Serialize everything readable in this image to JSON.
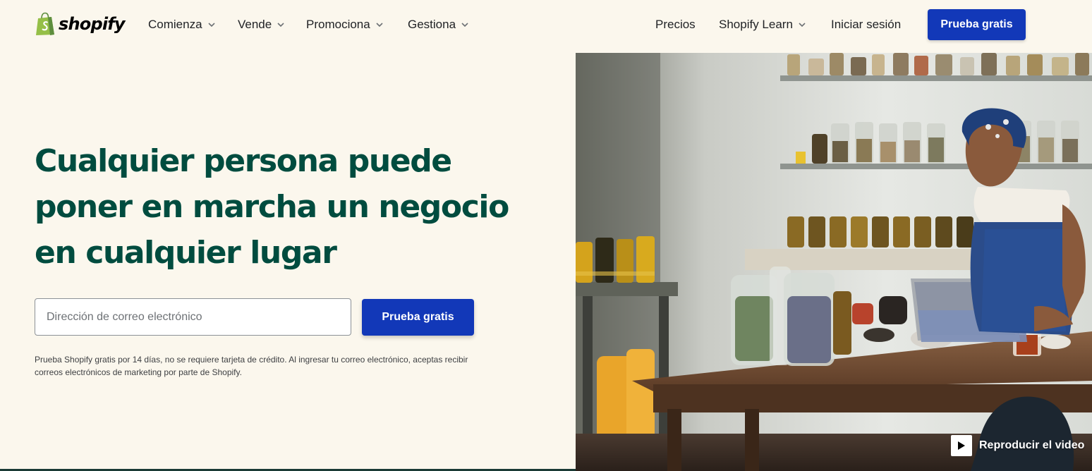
{
  "brand": {
    "name": "shopify",
    "color": "#95bf47"
  },
  "nav": {
    "left": [
      {
        "label": "Comienza",
        "dropdown": true
      },
      {
        "label": "Vende",
        "dropdown": true
      },
      {
        "label": "Promociona",
        "dropdown": true
      },
      {
        "label": "Gestiona",
        "dropdown": true
      }
    ],
    "right": [
      {
        "label": "Precios",
        "dropdown": false
      },
      {
        "label": "Shopify Learn",
        "dropdown": true
      },
      {
        "label": "Iniciar sesión",
        "dropdown": false
      }
    ],
    "cta_label": "Prueba gratis"
  },
  "hero": {
    "headline_lines": [
      "Cualquier persona puede",
      "poner en marcha un negocio",
      "en cualquier lugar"
    ],
    "email_placeholder": "Dirección de correo electrónico",
    "email_value": "",
    "cta_label": "Prueba gratis",
    "disclaimer": "Prueba Shopify gratis por 14 días, no se requiere tarjeta de crédito. Al ingresar tu correo electrónico, aceptas recibir correos electrónicos de marketing por parte de Shopify.",
    "video_label": "Reproducir el video",
    "video_icon": "play-icon"
  },
  "colors": {
    "background": "#fbf7ed",
    "headline": "#004c3f",
    "primary_button": "#1238b8"
  }
}
